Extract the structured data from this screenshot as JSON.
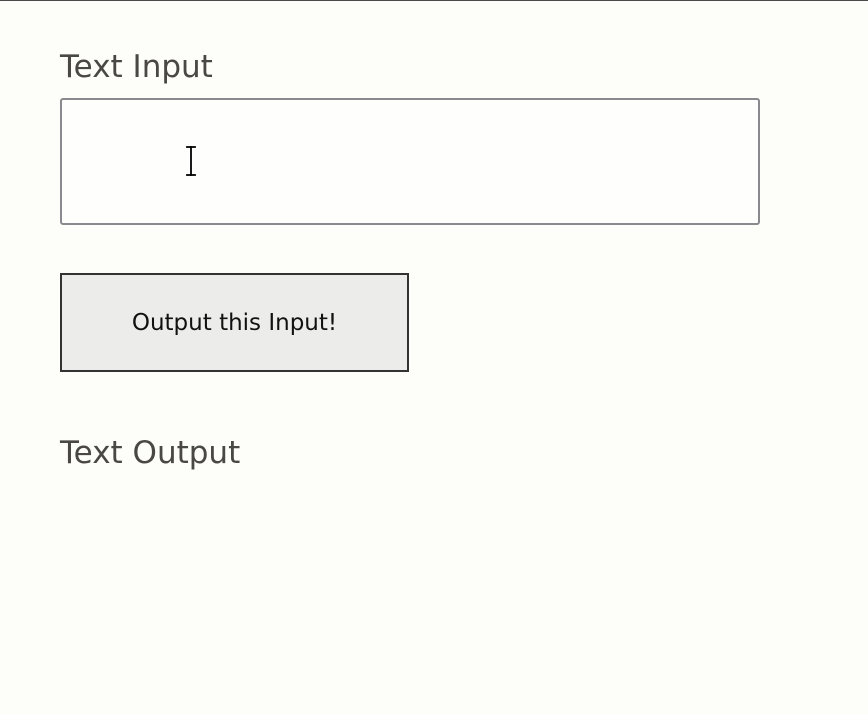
{
  "input_section": {
    "label": "Text Input",
    "value": "",
    "cursor_icon": "text-cursor-icon"
  },
  "action": {
    "button_label": "Output this Input!"
  },
  "output_section": {
    "label": "Text Output",
    "value": ""
  }
}
